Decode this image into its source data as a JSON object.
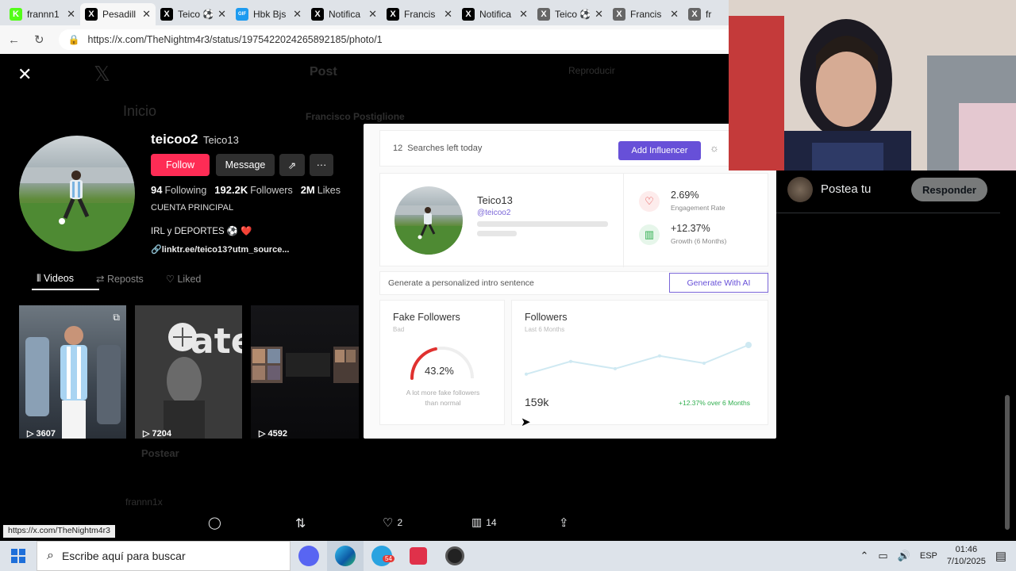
{
  "browser": {
    "tabs": [
      {
        "label": "frannn1",
        "icon": "K",
        "color": "#53fc18",
        "active": false
      },
      {
        "label": "Pesadill",
        "icon": "X",
        "color": "#000000",
        "active": true
      },
      {
        "label": "Teico ⚽",
        "icon": "X",
        "color": "#000000",
        "active": false
      },
      {
        "label": "Hbk Bjs",
        "icon": "GIF",
        "color": "#1d9bf0",
        "active": false
      },
      {
        "label": "Notifica",
        "icon": "X",
        "color": "#000000",
        "active": false
      },
      {
        "label": "Francis",
        "icon": "X",
        "color": "#000000",
        "active": false
      },
      {
        "label": "Notifica",
        "icon": "X",
        "color": "#000000",
        "active": false
      },
      {
        "label": "Teico ⚽",
        "icon": "X",
        "color": "#666666",
        "active": false
      },
      {
        "label": "Francis",
        "icon": "X",
        "color": "#666666",
        "active": false
      },
      {
        "label": "fr",
        "icon": "X",
        "color": "#666666",
        "active": false
      }
    ],
    "url": "https://x.com/TheNightm4r3/status/1975422024265892185/photo/1"
  },
  "background_post": {
    "header": "Post",
    "reproducir": "Reproducir",
    "home": "Inicio",
    "author": "Francisco Postiglione",
    "postear": "Postear",
    "user": "frannn1x"
  },
  "tiktok": {
    "username": "teicoo2",
    "nickname": "Teico13",
    "follow_label": "Follow",
    "message_label": "Message",
    "following_count": "94",
    "following_label": "Following",
    "followers_count": "192.2K",
    "followers_label": "Followers",
    "likes_count": "2M",
    "likes_label": "Likes",
    "bio_line1": "CUENTA PRINCIPAL",
    "bio_line2": "IRL y DEPORTES ⚽ ❤️",
    "link": "linktr.ee/teico13?utm_source...",
    "tabs": {
      "videos": "Videos",
      "reposts": "Reposts",
      "liked": "Liked"
    },
    "videos": [
      {
        "views": "3607"
      },
      {
        "views": "7204"
      },
      {
        "views": "4592"
      }
    ]
  },
  "panel": {
    "searches_count": "12",
    "searches_label": "Searches left today",
    "add_influencer": "Add Influencer",
    "name": "Teico13",
    "handle": "@teicoo2",
    "engagement_value": "2.69%",
    "engagement_label": "Engagement Rate",
    "growth_value": "+12.37%",
    "growth_label": "Growth (6 Months)",
    "intro_placeholder": "Generate a personalized intro sentence",
    "generate_label": "Generate With AI",
    "fake_title": "Fake Followers",
    "fake_sub": "Bad",
    "fake_value": "43.2%",
    "fake_fraction": 0.432,
    "fake_note": "A lot more fake followers than normal",
    "followers_title": "Followers",
    "followers_sub": "Last 6 Months",
    "followers_total": "159k",
    "followers_growth": "+12.37% over 6 Months",
    "accent": "#6750d8",
    "fake_color": "#e0312f"
  },
  "chart_data": {
    "type": "line",
    "title": "Followers",
    "subtitle": "Last 6 Months",
    "x": [
      1,
      2,
      3,
      4,
      5,
      6
    ],
    "values": [
      0.2,
      0.55,
      0.35,
      0.7,
      0.5,
      1.0
    ],
    "xlabel": "",
    "ylabel": ""
  },
  "right": {
    "postea": "Postea tu",
    "responder": "Responder"
  },
  "actions": {
    "likes": "2",
    "views": "14"
  },
  "status_url": "https://x.com/TheNightm4r3",
  "taskbar": {
    "search_placeholder": "Escribe aquí para buscar",
    "lang": "ESP",
    "time": "01:46",
    "date": "7/10/2025",
    "telegram_badge": "54"
  }
}
